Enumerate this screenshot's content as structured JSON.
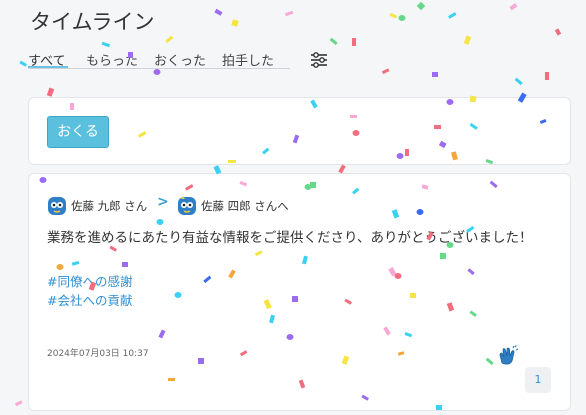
{
  "page": {
    "title": "タイムライン"
  },
  "tabs": [
    {
      "label": "すべて",
      "active": true
    },
    {
      "label": "もらった",
      "active": false
    },
    {
      "label": "おくった",
      "active": false
    },
    {
      "label": "拍手した",
      "active": false
    }
  ],
  "filter_icon": "sliders-icon",
  "send_button": {
    "label": "おくる"
  },
  "post": {
    "sender": "佐藤 九郎 さん",
    "arrow": ">",
    "recipient": "佐藤 四郎 さんへ",
    "message": "業務を進めるにあたり有益な情報をご提供くださり、ありがとうございました！",
    "tags": [
      "#同僚への感謝",
      "#会社への貢献"
    ],
    "date": "2024年07月03日 10:37",
    "clap_icon": "clapping-hands-icon",
    "clap_count": "1"
  },
  "colors": {
    "accent": "#5bc0de",
    "link": "#2f8fd1",
    "background": "#f5f6f8"
  }
}
